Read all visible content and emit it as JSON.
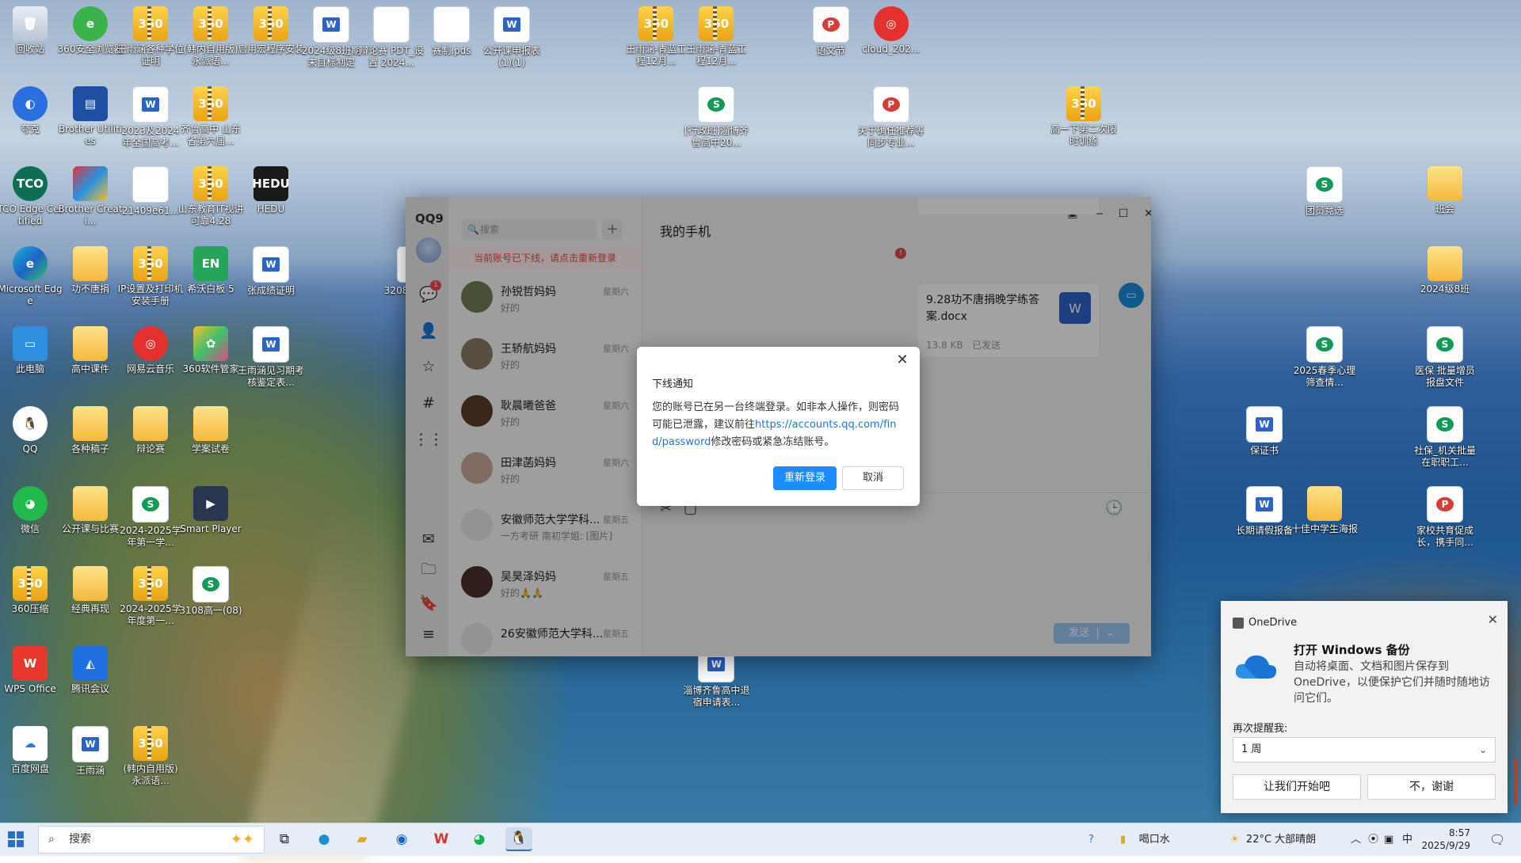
{
  "desktop": {
    "icons": [
      {
        "label": "回收站",
        "type": "bin"
      },
      {
        "label": "360安全浏览器",
        "type": "browser360"
      },
      {
        "label": "王雨涵各种学位证明",
        "type": "zip"
      },
      {
        "label": "(韩内自用版) 永派语...",
        "type": "zip"
      },
      {
        "label": "启用宏程序安装",
        "type": "zip"
      },
      {
        "label": "2024级8班期末目标制定",
        "type": "word"
      },
      {
        "label": "辩论赛 PDT_设置 2024...",
        "type": "doc"
      },
      {
        "label": "赛制.pds",
        "type": "doc"
      },
      {
        "label": "公开课申报表(1)(1)",
        "type": "word"
      },
      {
        "label": "王雨涵-青蓝工程12月...",
        "type": "zip"
      },
      {
        "label": "王雨涵-青蓝工程12月...",
        "type": "zip"
      },
      {
        "label": "语文节",
        "type": "ppt"
      },
      {
        "label": "cloud_202...",
        "type": "netease"
      },
      {
        "label": "夸克",
        "type": "quark"
      },
      {
        "label": "Brother Utilities",
        "type": "brother"
      },
      {
        "label": "2023及2024年全国高考...",
        "type": "word"
      },
      {
        "label": "齐鲁高中 山东省第六届...",
        "type": "zip"
      },
      {
        "label": "[行政班]淄博齐鲁高中20...",
        "type": "sheet"
      },
      {
        "label": "关于确任推荐等同步专业...",
        "type": "pdf"
      },
      {
        "label": "高一下第二次限时训练",
        "type": "zip"
      },
      {
        "label": "TCO Edge Certified",
        "type": "tco"
      },
      {
        "label": "Brother Creati...",
        "type": "brother2"
      },
      {
        "label": "21409e61...",
        "type": "doc"
      },
      {
        "label": "山东教育IT视讲可靠4.28",
        "type": "zip"
      },
      {
        "label": "HEDU",
        "type": "hedu"
      },
      {
        "label": "团员竞选",
        "type": "sheet"
      },
      {
        "label": "班会",
        "type": "folder"
      },
      {
        "label": "Microsoft Edge",
        "type": "edge"
      },
      {
        "label": "功不唐捐",
        "type": "folder"
      },
      {
        "label": "IP设置及打印机安装手册",
        "type": "zip"
      },
      {
        "label": "希沃白板 5",
        "type": "en"
      },
      {
        "label": "张成绩证明",
        "type": "word"
      },
      {
        "label": "3208高二(08)",
        "type": "sheet"
      },
      {
        "label": "2024级8班",
        "type": "folder"
      },
      {
        "label": "此电脑",
        "type": "pc"
      },
      {
        "label": "高中课件",
        "type": "folder"
      },
      {
        "label": "网易云音乐",
        "type": "netease"
      },
      {
        "label": "360软件管家",
        "type": "soft360"
      },
      {
        "label": "王雨涵见习期考核鉴定表...",
        "type": "word"
      },
      {
        "label": "2025春季心理筛查情...",
        "type": "sheet"
      },
      {
        "label": "医保 批量增员报盘文件",
        "type": "sheet"
      },
      {
        "label": "QQ",
        "type": "qq"
      },
      {
        "label": "各种稿子",
        "type": "folder"
      },
      {
        "label": "辩论赛",
        "type": "folder"
      },
      {
        "label": "学案试卷",
        "type": "folder"
      },
      {
        "label": "保证书",
        "type": "word"
      },
      {
        "label": "社保_机关批量在职职工...",
        "type": "sheet"
      },
      {
        "label": "微信",
        "type": "wechat"
      },
      {
        "label": "公开课与比赛",
        "type": "folder"
      },
      {
        "label": "2024-2025学年第一学...",
        "type": "sheet"
      },
      {
        "label": "Smart Player",
        "type": "smart"
      },
      {
        "label": "长期请假报备",
        "type": "word"
      },
      {
        "label": "十佳中学生海报",
        "type": "folder"
      },
      {
        "label": "家校共育促成长，携手同...",
        "type": "ppt"
      },
      {
        "label": "360压缩",
        "type": "zip"
      },
      {
        "label": "经典再现",
        "type": "folder"
      },
      {
        "label": "2024-2025学年度第一...",
        "type": "zip"
      },
      {
        "label": "3108高一(08)",
        "type": "sheet"
      },
      {
        "label": "WPS Office",
        "type": "wps"
      },
      {
        "label": "腾讯会议",
        "type": "meeting"
      },
      {
        "label": "淄博齐鲁高中退宿申请表...",
        "type": "word"
      },
      {
        "label": "百度网盘",
        "type": "baidu"
      },
      {
        "label": "王雨涵",
        "type": "word"
      },
      {
        "label": "(韩内自用版) 永派语...",
        "type": "zip"
      }
    ]
  },
  "qq": {
    "logo": "QQ9",
    "rail_badge": "1",
    "search_placeholder": "搜索",
    "offline_banner": "当前账号已下线，请点击重新登录",
    "chat_title": "我的手机",
    "contacts": [
      {
        "name": "孙锐哲妈妈",
        "msg": "好的",
        "time": "星期六",
        "avatar": "#6f7d56"
      },
      {
        "name": "王轿航妈妈",
        "msg": "好的",
        "time": "星期六",
        "avatar": "#8a7a66"
      },
      {
        "name": "耿晨曦爸爸",
        "msg": "好的",
        "time": "星期六",
        "avatar": "#5a3d2c"
      },
      {
        "name": "田津菡妈妈",
        "msg": "好的",
        "time": "星期六",
        "avatar": "#c9a99a"
      },
      {
        "name": "安徽师范大学学科...",
        "msg": "一方考研 南初学姐: [图片]",
        "time": "星期五",
        "avatar": "#e6e6e6"
      },
      {
        "name": "吴昊泽妈妈",
        "msg": "好的🙏🙏",
        "time": "星期五",
        "avatar": "#4c2f2a"
      },
      {
        "name": "26安徽师范大学科...",
        "msg": "",
        "time": "星期五",
        "avatar": "#e6e6e6"
      }
    ],
    "file": {
      "name": "9.28功不唐捐晚学练答案.docx",
      "size": "13.8 KB",
      "status": "已发送"
    },
    "send_label": "发送"
  },
  "dialog": {
    "title": "下线通知",
    "body_before": "您的账号已在另一台终端登录。如非本人操作，则密码可能已泄露，建议前往",
    "link": "https://accounts.qq.com/find/password",
    "body_after": "修改密码或紧急冻结账号。",
    "relogin": "重新登录",
    "cancel": "取消"
  },
  "toast": {
    "app": "OneDrive",
    "heading": "打开 Windows 备份",
    "body": "自动将桌面、文档和图片保存到 OneDrive，以便保护它们并随时随地访问它们。",
    "remind_label": "再次提醒我:",
    "remind_value": "1 周",
    "btn_start": "让我们开始吧",
    "btn_no": "不，谢谢"
  },
  "taskbar": {
    "search_placeholder": "搜索",
    "drink": "喝口水",
    "weather": "22°C  大部晴朗",
    "ime": "中",
    "time": "8:57",
    "date": "2025/9/29"
  },
  "colors": {
    "accent": "#1a8cff",
    "qq_link": "#1a74e8",
    "offline": "#e04a4a"
  }
}
